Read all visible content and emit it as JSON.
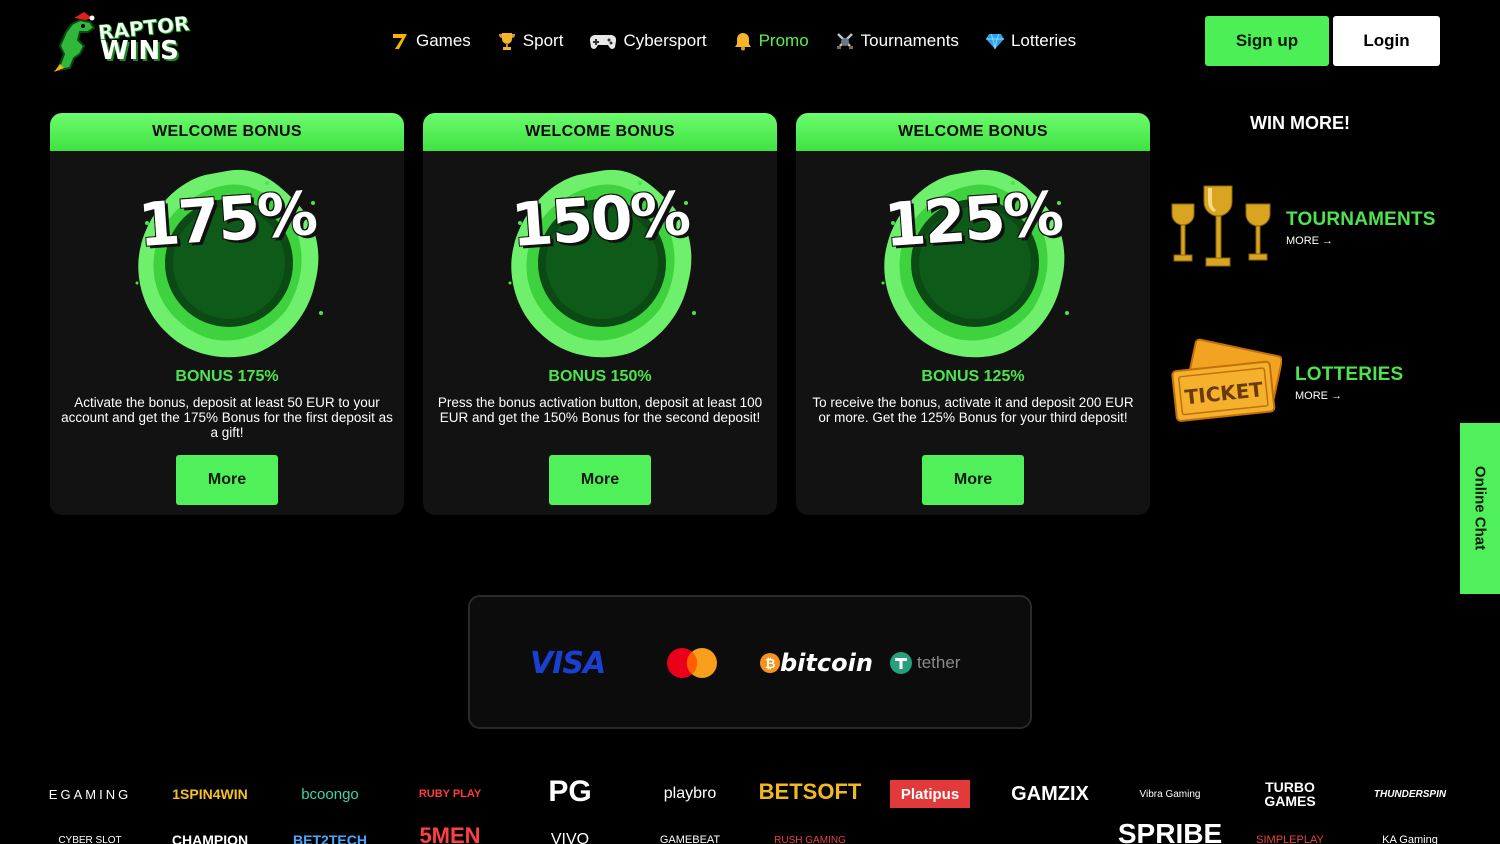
{
  "header": {
    "logo": {
      "line1": "RAPTOR",
      "line2": "WINS"
    },
    "nav": [
      {
        "label": "Games",
        "icon": "seven-icon"
      },
      {
        "label": "Sport",
        "icon": "trophy-icon"
      },
      {
        "label": "Cybersport",
        "icon": "gamepad-icon"
      },
      {
        "label": "Promo",
        "icon": "bell-icon",
        "active": true
      },
      {
        "label": "Tournaments",
        "icon": "crossed-swords-icon"
      },
      {
        "label": "Lotteries",
        "icon": "diamond-icon"
      }
    ],
    "signup_label": "Sign up",
    "login_label": "Login"
  },
  "bonuses": [
    {
      "header": "WELCOME BONUS",
      "percent": "175%",
      "title": "BONUS 175%",
      "description": "Activate the bonus, deposit at least 50 EUR to your account and get the 175% Bonus for the first deposit as a gift!",
      "button": "More"
    },
    {
      "header": "WELCOME BONUS",
      "percent": "150%",
      "title": "BONUS 150%",
      "description": "Press the bonus activation button, deposit at least 100 EUR and get the 150% Bonus for the second deposit!",
      "button": "More"
    },
    {
      "header": "WELCOME BONUS",
      "percent": "125%",
      "title": "BONUS 125%",
      "description": "To receive the bonus, activate it and deposit 200 EUR or more. Get the 125% Bonus for your third deposit!",
      "button": "More"
    }
  ],
  "win_more": {
    "title": "WIN MORE!",
    "tournaments": {
      "label": "TOURNAMENTS",
      "more": "MORE"
    },
    "lotteries": {
      "label": "LOTTERIES",
      "more": "MORE",
      "ticket_text": "TICKET"
    }
  },
  "online_chat": "Online Chat",
  "payments": {
    "visa": "VISA",
    "bitcoin": "bitcoin",
    "tether": "tether"
  },
  "providers_row1": [
    "EGAMING",
    "1SPIN4WIN",
    "bcoongo",
    "RUBY PLAY",
    "PG",
    "playbro",
    "BETSOFT",
    "Platipus",
    "GAMZIX",
    "Vibra Gaming",
    "TURBO GAMES",
    "THUNDERSPIN"
  ],
  "providers_row2": [
    "CYBER SLOT",
    "CHAMPION",
    "BET2TECH",
    "5MEN",
    "VIVO",
    "GAMEBEAT",
    "RUSH GAMING",
    "",
    "",
    "SPRIBE",
    "SIMPLEPLAY",
    "KA Gaming"
  ],
  "colors": {
    "accent": "#4de44f",
    "button": "#4ff05a",
    "visa": "#1a3fd1",
    "bitcoin": "#f7931a",
    "tether": "#26a17b"
  }
}
